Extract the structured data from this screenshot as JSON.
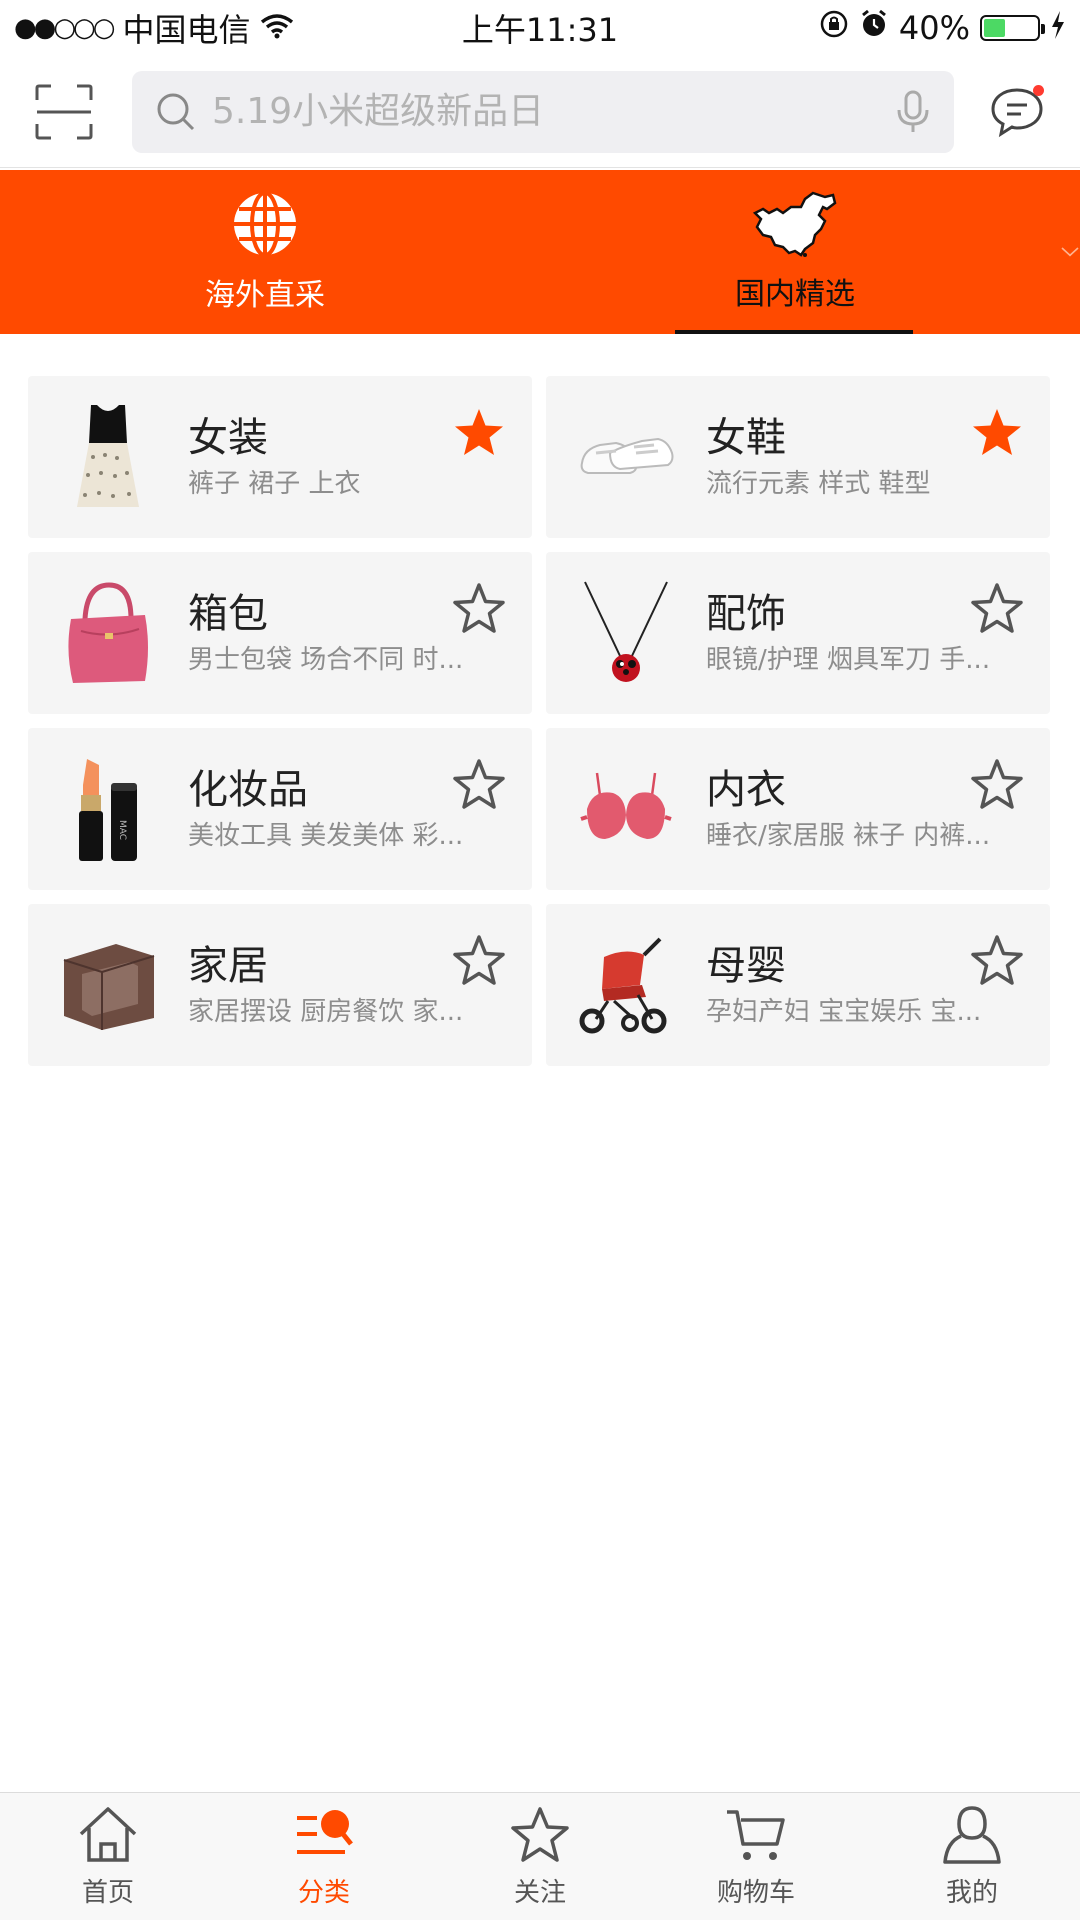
{
  "status_bar": {
    "signal": "●●○○○",
    "carrier": "中国电信",
    "time": "上午11:31",
    "battery": "40%",
    "battery_level": 0.4
  },
  "search": {
    "placeholder": "5.19小米超级新品日"
  },
  "region_tabs": [
    {
      "label": "海外直采",
      "icon": "globe-icon",
      "active": false
    },
    {
      "label": "国内精选",
      "icon": "china-map-icon",
      "active": true
    }
  ],
  "categories": [
    {
      "name": "女装",
      "sub": "裤子 裙子 上衣",
      "favorited": true,
      "image": "dress"
    },
    {
      "name": "女鞋",
      "sub": "流行元素 样式 鞋型",
      "favorited": true,
      "image": "sneakers"
    },
    {
      "name": "箱包",
      "sub": "男士包袋 场合不同 时...",
      "favorited": false,
      "image": "handbag"
    },
    {
      "name": "配饰",
      "sub": "眼镜/护理 烟具军刀 手...",
      "favorited": false,
      "image": "necklace"
    },
    {
      "name": "化妆品",
      "sub": "美妆工具 美发美体 彩...",
      "favorited": false,
      "image": "lipstick"
    },
    {
      "name": "内衣",
      "sub": "睡衣/家居服 袜子 内裤...",
      "favorited": false,
      "image": "bra"
    },
    {
      "name": "家居",
      "sub": "家居摆设 厨房餐饮 家...",
      "favorited": false,
      "image": "armchair"
    },
    {
      "name": "母婴",
      "sub": "孕妇产妇 宝宝娱乐 宝...",
      "favorited": false,
      "image": "stroller"
    }
  ],
  "tab_bar": [
    {
      "label": "首页",
      "icon": "home-icon"
    },
    {
      "label": "分类",
      "icon": "category-search-icon"
    },
    {
      "label": "关注",
      "icon": "star-icon"
    },
    {
      "label": "购物车",
      "icon": "cart-icon"
    },
    {
      "label": "我的",
      "icon": "user-icon"
    }
  ],
  "colors": {
    "accent": "#ff4a00",
    "star_filled": "#ff4a00",
    "star_outline": "#555555"
  }
}
